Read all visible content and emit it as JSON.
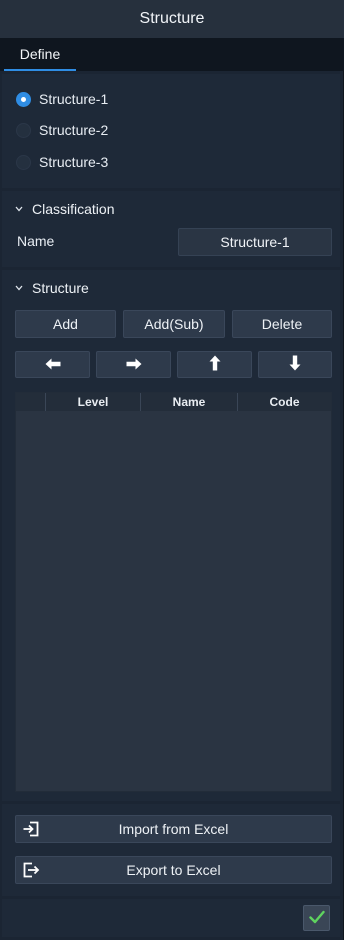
{
  "window": {
    "title": "Structure"
  },
  "tabs": [
    {
      "label": "Define",
      "active": true
    }
  ],
  "structures": {
    "selected": 0,
    "items": [
      {
        "label": "Structure-1"
      },
      {
        "label": "Structure-2"
      },
      {
        "label": "Structure-3"
      }
    ]
  },
  "classification": {
    "title": "Classification",
    "name_label": "Name",
    "name_value": "Structure-1"
  },
  "structure": {
    "title": "Structure",
    "add_label": "Add",
    "add_sub_label": "Add(Sub)",
    "delete_label": "Delete",
    "arrow_icons": [
      "arrow-left-icon",
      "arrow-right-icon",
      "arrow-up-icon",
      "arrow-down-icon"
    ],
    "grid": {
      "columns": [
        "",
        "Level",
        "Name",
        "Code"
      ],
      "rows": []
    }
  },
  "excel": {
    "import_label": "Import from Excel",
    "export_label": "Export to Excel"
  },
  "footer": {
    "confirm_icon": "check-icon"
  },
  "colors": {
    "accent": "#2f8de4",
    "confirm": "#5fd35f"
  }
}
